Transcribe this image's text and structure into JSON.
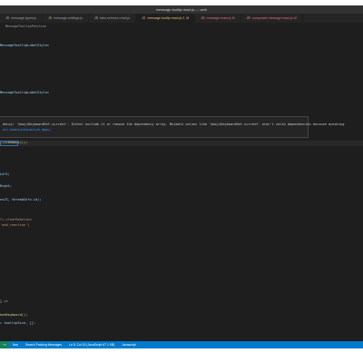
{
  "window": {
    "title": "message-tooltip.react.js — web"
  },
  "tabs": [
    {
      "label": "message.types.js",
      "state": "normal"
    },
    {
      "label": "message-settings.js",
      "state": "normal"
    },
    {
      "label": "tabs-selector.react.js",
      "state": "normal"
    },
    {
      "label": "message-tooltip.react.js 2, M",
      "state": "active"
    },
    {
      "label": "message.react.js M",
      "state": "modified"
    },
    {
      "label": "composed-message.react.js M",
      "state": "modified"
    }
  ],
  "breadcrumb": "MessageTooltipPosition",
  "code_lines": [
    {
      "text": "MessageTooltipLabelStyle>",
      "cls": "var"
    },
    {
      "text": "MessageTooltipLabelStyle>",
      "cls": "var"
    },
    {
      "text": "ClickedOut());",
      "cls": "fn"
    },
    {
      "text": "Left;",
      "cls": "var"
    },
    {
      "text": "Right;",
      "cls": "var"
    },
    {
      "text": "nsJS, threadInfo.id);",
      "cls": "var"
    },
    {
      "text": "ll-clearReaction",
      "cls": "str"
    },
    {
      "text": "'add_reaction')",
      "cls": "str"
    },
    {
      "text": "} =>",
      "cls": ""
    },
    {
      "text": "hoeKeyboard();",
      "cls": "fn"
    },
    {
      "text": "= tooltipSize, [];",
      "cls": "var"
    }
  ],
  "hover": {
    "message": "dency: 'emojiKeyboardRef.current'. Either exclude it or remove the dependency array. Mutable values like 'emojiKeyboardRef.current' aren't valid dependencies because mutating",
    "link": "ect-hooks/exhaustive-deps)"
  },
  "statusbar": {
    "remote": "⌥",
    "branch": "flow",
    "sync": "Search Packing Messages",
    "position": "Ln 8, Col 15 (JavaScript 67.1 KB)",
    "mode": "Javascript"
  }
}
